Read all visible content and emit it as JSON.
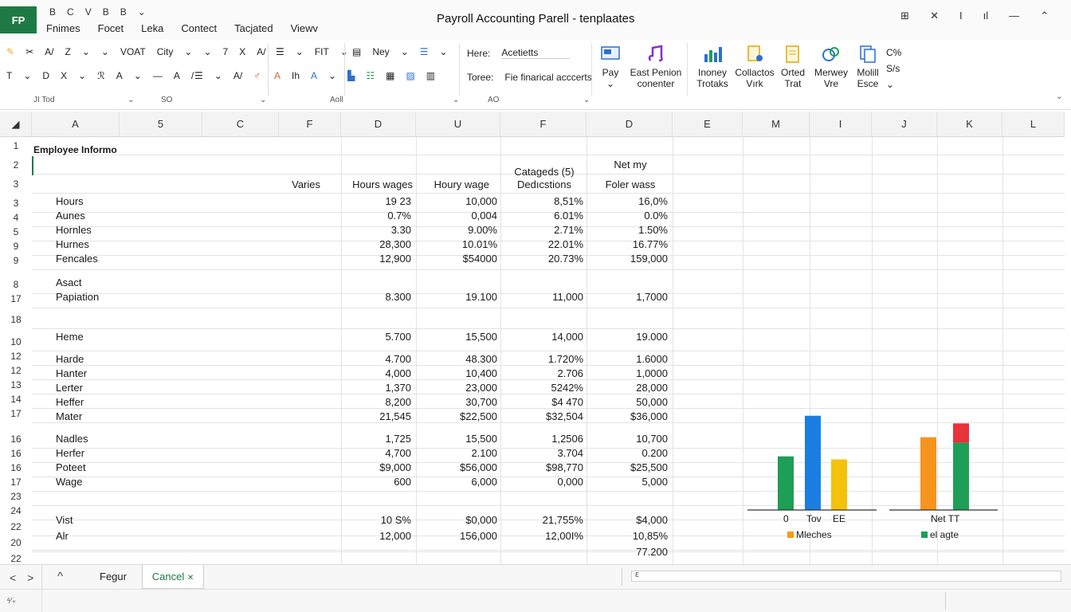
{
  "app": {
    "icon_text": "FP",
    "title": "Payroll Accounting Parell - tenplaates",
    "quick_access": [
      "B",
      "C",
      "V",
      "B",
      "B",
      "⌄"
    ],
    "window_controls": [
      "⊞",
      "✕",
      "I",
      "ıl",
      "—",
      "⌃"
    ]
  },
  "menu": [
    "Fnimes",
    "Focet",
    "Leka",
    "Contect",
    "Tacjated",
    "Viewv"
  ],
  "ribbon": {
    "row1_font": [
      "✂",
      "A/",
      "Z",
      "⌄",
      "⌄",
      "VOAT",
      "City",
      "⌄",
      "⌄",
      "7",
      "X",
      "A/"
    ],
    "row1_align": [
      "☰",
      "⌄",
      "FIT",
      "⌄"
    ],
    "row1_styles": [
      "Ney",
      "⌄",
      "☰",
      "⌄"
    ],
    "row2_font": [
      "T",
      "⌄",
      "D",
      "X",
      "⌄",
      "ℛ",
      "A",
      "⌄",
      "—",
      "A",
      "/"
    ],
    "row2_align": [
      "☰",
      "⌄",
      "A/",
      "♂"
    ],
    "row2_styles": [
      "A",
      "Ih",
      "A",
      "⌄"
    ],
    "info_label1": "Here:",
    "info_value1": "Acetietts",
    "info_label2": "Toree:",
    "info_value2": "Fie finarical acccerts",
    "tools": [
      {
        "label": "Pay",
        "sub": "⌄"
      },
      {
        "label": "East Penion",
        "sub": "conenter"
      },
      {
        "label": "Inoney",
        "sub": "Trotaks"
      },
      {
        "label": "Collactos",
        "sub": "Vırk"
      },
      {
        "label": "Orted",
        "sub": "Trat"
      },
      {
        "label": "Merwey",
        "sub": "Vre"
      },
      {
        "label": "Molill",
        "sub": "Esce"
      }
    ],
    "side_labels": [
      "C%",
      "S/s",
      "⌄"
    ],
    "namebox": [
      "JI Tod",
      "⌄",
      "SO",
      "⌄",
      "Aoll",
      "⌄",
      "AO",
      "⌄"
    ]
  },
  "grid": {
    "columns": [
      "A",
      "5",
      "C",
      "F",
      "D",
      "U",
      "F",
      "D",
      "E",
      "M",
      "I",
      "J",
      "K",
      "L"
    ],
    "row_numbers": [
      "1",
      "2",
      "3",
      "3",
      "4",
      "5",
      "9",
      "9",
      "8",
      "17",
      "18",
      "10",
      "12",
      "12",
      "13",
      "14",
      "17",
      "16",
      "16",
      "16",
      "17",
      "23",
      "24",
      "22",
      "20",
      "22"
    ],
    "title": "Employee Informo",
    "headers": {
      "c": "Varies",
      "d": "Hours wages",
      "e": "Houry wage",
      "f_top": "Catageds (5)",
      "f_bottom": "Dedıcstions",
      "g_top": "Net my",
      "g_bottom": "Foler wass"
    },
    "rows": [
      {
        "label": "Hours",
        "d": "19 23",
        "e": "10,000",
        "f": "8,51%",
        "g": "16,0%"
      },
      {
        "label": "Aunes",
        "d": "0.7%",
        "e": "0,004",
        "f": "6.01%",
        "g": "0.0%"
      },
      {
        "label": "Hornles",
        "d": "3.30",
        "e": "9.00%",
        "f": "2.71%",
        "g": "1.50%"
      },
      {
        "label": "Hurnes",
        "d": "28,300",
        "e": "10.01%",
        "f": "22.01%",
        "g": "16.77%"
      },
      {
        "label": "Fencales",
        "d": "12,900",
        "e": "$54000",
        "f": "20.73%",
        "g": "159,000"
      },
      {
        "label": "Asact",
        "d": "",
        "e": "",
        "f": "",
        "g": ""
      },
      {
        "label": "Papiation",
        "d": "8.300",
        "e": "19.100",
        "f": "11,000",
        "g": "1,7000"
      },
      {
        "label": "",
        "d": "",
        "e": "",
        "f": "",
        "g": ""
      },
      {
        "label": "Heme",
        "d": "5.700",
        "e": "15,500",
        "f": "14,000",
        "g": "19.000"
      },
      {
        "label": "Harde",
        "d": "4.700",
        "e": "48.300",
        "f": "1.720%",
        "g": "1.6000"
      },
      {
        "label": "Hanter",
        "d": "4,000",
        "e": "10,400",
        "f": "2.706",
        "g": "1,0000"
      },
      {
        "label": "Lerter",
        "d": "1,370",
        "e": "23,000",
        "f": "5242%",
        "g": "28,000"
      },
      {
        "label": "Heffer",
        "d": "8,200",
        "e": "30,700",
        "f": "$4 470",
        "g": "50,000"
      },
      {
        "label": "Mater",
        "d": "21,545",
        "e": "$22,500",
        "f": "$32,504",
        "g": "$36,000"
      },
      {
        "label": "Nadles",
        "d": "1,725",
        "e": "15,500",
        "f": "1,2506",
        "g": "10,700"
      },
      {
        "label": "Herfer",
        "d": "4,700",
        "e": "2.100",
        "f": "3.704",
        "g": "0.200"
      },
      {
        "label": "Poteet",
        "d": "$9,000",
        "e": "$56,000",
        "f": "$98,770",
        "g": "$25,500"
      },
      {
        "label": "Wage",
        "d": "600",
        "e": "6,000",
        "f": "0,000",
        "g": "5,000"
      },
      {
        "label": "",
        "d": "",
        "e": "",
        "f": "",
        "g": ""
      },
      {
        "label": "",
        "d": "",
        "e": "",
        "f": "",
        "g": ""
      },
      {
        "label": "Vist",
        "d": "10 S%",
        "e": "$0,000",
        "f": "21,755%",
        "g": "$4,000"
      },
      {
        "label": "Alr",
        "d": "12,000",
        "e": "156,000",
        "f": "12,00I%",
        "g": "10,85%"
      },
      {
        "label": "",
        "d": "",
        "e": "",
        "f": "",
        "g": "77.200"
      }
    ]
  },
  "chart_data": {
    "type": "bar",
    "title": "",
    "xlabel": "",
    "ylabel": "",
    "left_group": {
      "axis_labels": [
        "0",
        "Tov",
        "EE"
      ],
      "legend": "Mleches",
      "legend_color": "#f39c12",
      "values": [
        70,
        123,
        66
      ],
      "colors": [
        "#1e9e57",
        "#1a7fe0",
        "#f4c20d"
      ]
    },
    "right_group": {
      "axis_labels": [
        "Net TT"
      ],
      "legend": "el agte",
      "legend_color": "#1e9e57",
      "bars": [
        {
          "value": 95,
          "color": "#f7941d"
        },
        {
          "value": 113,
          "segments": [
            {
              "value": 88,
              "color": "#1e9e57"
            },
            {
              "value": 25,
              "color": "#e8323c"
            }
          ]
        }
      ]
    },
    "ylim": [
      0,
      130
    ]
  },
  "footer": {
    "nav_prev": "<",
    "nav_next": ">",
    "nav_up": "^",
    "sheet1": "Fegur",
    "sheet2": "Cancel",
    "sheet2_icon": "✕",
    "status_left": "⁴⁄₊",
    "scroll_marker": "ε"
  }
}
